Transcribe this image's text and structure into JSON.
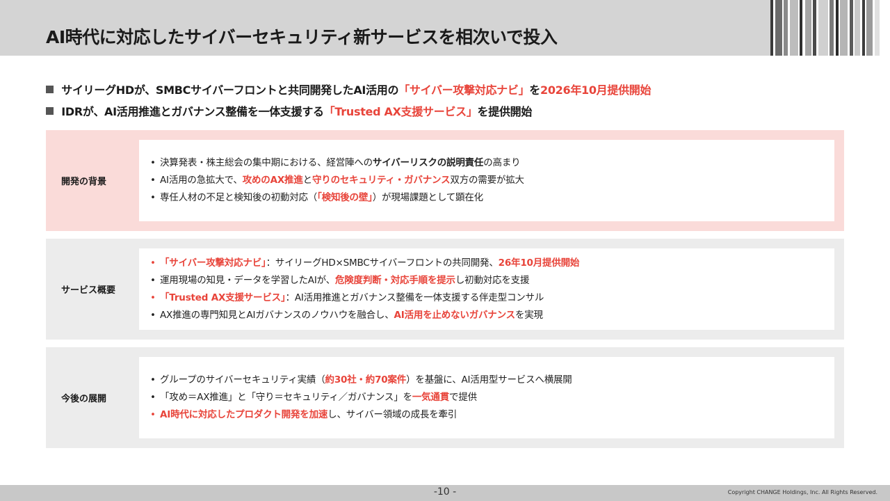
{
  "header": {
    "title": "AI時代に対応したサイバーセキュリティ新サービスを相次いで投入"
  },
  "headlines": [
    {
      "parts": [
        {
          "text": "サイリーグHDが、SMBCサイバーフロントと共同開発したAI活用の",
          "red": false
        },
        {
          "text": "「サイバー攻撃対応ナビ」",
          "red": true
        },
        {
          "text": "を",
          "red": false
        },
        {
          "text": "2026年10月提供開始",
          "red": true
        }
      ]
    },
    {
      "parts": [
        {
          "text": "IDRが、AI活用推進とガバナンス整備を一体支援する",
          "red": false
        },
        {
          "text": "「Trusted AX支援サービス」",
          "red": true
        },
        {
          "text": "を提供開始",
          "red": false
        }
      ]
    }
  ],
  "sections": [
    {
      "label": "開発の背景",
      "items": [
        {
          "bullet_red": false,
          "parts": [
            {
              "text": "決算発表・株主総会の集中期における、経営陣への",
              "style": ""
            },
            {
              "text": "サイバーリスクの説明責任",
              "style": "bold"
            },
            {
              "text": "の高まり",
              "style": ""
            }
          ]
        },
        {
          "bullet_red": false,
          "parts": [
            {
              "text": "AI活用の急拡大で、",
              "style": ""
            },
            {
              "text": "攻めのAX推進",
              "style": "red"
            },
            {
              "text": "と",
              "style": ""
            },
            {
              "text": "守りのセキュリティ・ガバナンス",
              "style": "red"
            },
            {
              "text": "双方の需要が拡大",
              "style": ""
            }
          ]
        },
        {
          "bullet_red": false,
          "parts": [
            {
              "text": "専任人材の不足と検知後の初動対応（",
              "style": ""
            },
            {
              "text": "「検知後の壁」",
              "style": "red"
            },
            {
              "text": "）が現場課題として顕在化",
              "style": ""
            }
          ]
        }
      ]
    },
    {
      "label": "サービス概要",
      "items": [
        {
          "bullet_red": true,
          "parts": [
            {
              "text": "「サイバー攻撃対応ナビ」",
              "style": "red"
            },
            {
              "text": "：サイリーグHD×SMBCサイバーフロントの共同開発、",
              "style": ""
            },
            {
              "text": "26年10月提供開始",
              "style": "red"
            }
          ]
        },
        {
          "bullet_red": false,
          "parts": [
            {
              "text": "運用現場の知見・データを学習したAIが、",
              "style": ""
            },
            {
              "text": "危険度判断・対応手順を提示",
              "style": "red"
            },
            {
              "text": "し初動対応を支援",
              "style": ""
            }
          ]
        },
        {
          "bullet_red": true,
          "parts": [
            {
              "text": "「Trusted AX支援サービス」",
              "style": "red"
            },
            {
              "text": "：AI活用推進とガバナンス整備を一体支援する伴走型コンサル",
              "style": ""
            }
          ]
        },
        {
          "bullet_red": false,
          "parts": [
            {
              "text": "AX推進の専門知見とAIガバナンスのノウハウを融合し、",
              "style": ""
            },
            {
              "text": "AI活用を止めないガバナンス",
              "style": "red"
            },
            {
              "text": "を実現",
              "style": ""
            }
          ]
        }
      ]
    },
    {
      "label": "今後の展開",
      "items": [
        {
          "bullet_red": false,
          "parts": [
            {
              "text": "グループのサイバーセキュリティ実績（",
              "style": ""
            },
            {
              "text": "約30社・約70案件",
              "style": "red"
            },
            {
              "text": "）を基盤に、AI活用型サービスへ横展開",
              "style": ""
            }
          ]
        },
        {
          "bullet_red": false,
          "parts": [
            {
              "text": "「攻め＝AX推進」と「守り＝セキュリティ／ガバナンス」を",
              "style": ""
            },
            {
              "text": "一気通貫",
              "style": "red"
            },
            {
              "text": "で提供",
              "style": ""
            }
          ]
        },
        {
          "bullet_red": true,
          "parts": [
            {
              "text": "AI時代に対応したプロダクト開発を加速",
              "style": "red"
            },
            {
              "text": "し、サイバー領域の成長を牽引",
              "style": ""
            }
          ]
        }
      ]
    }
  ],
  "footer": {
    "page_number": "-10 -",
    "copyright": "Copyright CHANGE Holdings, Inc. All Rights Reserved."
  },
  "colors": {
    "accent_red": "#e8443a",
    "header_bg": "#d4d4d4",
    "section_pink": "#fadbd9",
    "section_gray": "#ececec"
  }
}
